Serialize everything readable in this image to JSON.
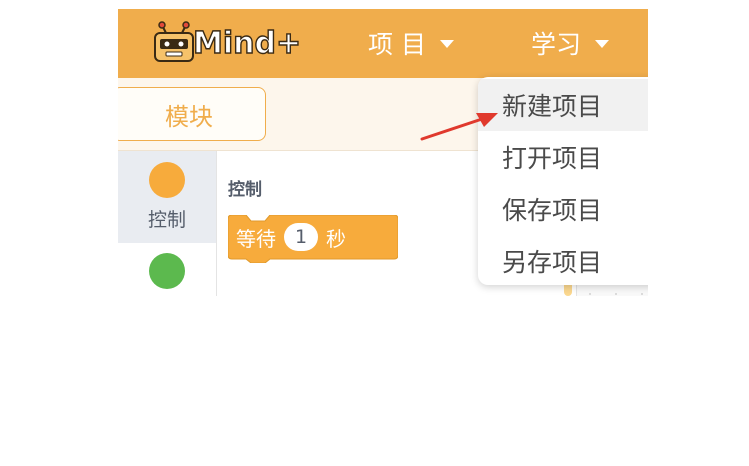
{
  "app": {
    "logo_text": "Mind+"
  },
  "topbar": {
    "menus": [
      {
        "label": "项 目"
      },
      {
        "label": "学习"
      }
    ]
  },
  "toolbar": {
    "modules_tab_label": "模块"
  },
  "categories": [
    {
      "label": "控制",
      "color": "#f7ab3c"
    },
    {
      "label": "",
      "color": "#5cb94e"
    }
  ],
  "palette": {
    "section_title": "控制",
    "blocks": [
      {
        "prefix": "等待",
        "value": "1",
        "suffix": "秒"
      }
    ]
  },
  "dropdown": {
    "items": [
      {
        "label": "新建项目"
      },
      {
        "label": "打开项目"
      },
      {
        "label": "保存项目"
      },
      {
        "label": "另存项目"
      }
    ]
  },
  "colors": {
    "topbar": "#f0ad4c",
    "accent": "#f0ad4c",
    "annotation_arrow": "#e0392d"
  },
  "annotation": {
    "icon": "red-arrow-icon"
  }
}
